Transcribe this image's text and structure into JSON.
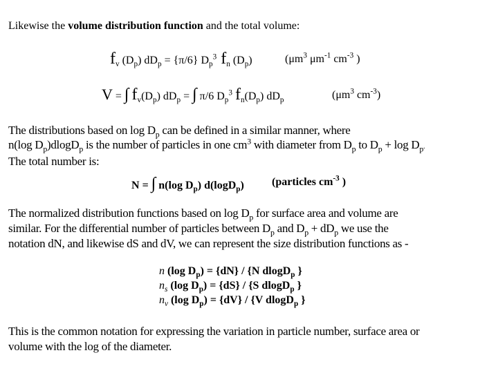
{
  "intro": {
    "prefix": "Likewise the ",
    "bold": "volume distribution function",
    "suffix": " and the total volume:"
  },
  "eq_volume_dist": {
    "f": "f",
    "sub_v": "v",
    "arg1": " (D",
    "p": "p",
    "close": ")",
    "dDp": " dD",
    "eq": " = {π/6} D",
    "cube": "3",
    "f2": " f",
    "sub_n": "n",
    "arg2": " (D",
    "units": "(μm",
    "u3": "3",
    "um": " μm",
    "um_exp": "-1",
    "cm": " cm",
    "cm_exp": "-3",
    "units_close": " )"
  },
  "eq_total_volume": {
    "V": "V",
    "eq": " = ",
    "integral": "∫",
    "f": "f",
    "sub_v": "v",
    "arg": "(D",
    "p": "p",
    "close": ")",
    "dDp": " dD",
    "eq2": " = ",
    "pi6": " π/6 D",
    "cube": "3",
    "f2": "f",
    "sub_n": "n",
    "units": "(μm",
    "u3": "3",
    "cm": " cm",
    "cm_exp": "-3",
    "units_close": ")"
  },
  "para_log": {
    "line1_a": "The distributions based on log D",
    "line1_p": "p",
    "line1_b": " can be defined in a similar manner, where",
    "line2_a": "n(log D",
    "line2_b": ")dlogD",
    "line2_c": " is the number of particles in one cm",
    "line2_exp": "3",
    "line2_d": " with diameter from D",
    "line2_e": " to D",
    "line2_f": " + log D",
    "line2_g": ".",
    "line3": "The total number is:"
  },
  "eq_total_number": {
    "N": "N",
    "eq": " = ",
    "integral": "∫",
    "body_a": " n(log D",
    "p": "p",
    "body_b": ") d(logD",
    "body_c": ")",
    "units": "(particles cm",
    "units_exp": "-3",
    "units_close": " )"
  },
  "para_normalized": {
    "line1_a": " The normalized distribution functions based on log D",
    "p": "p",
    "line1_b": " for surface area and volume are",
    "line2_a": "similar. For the differential number of particles between D",
    "line2_b": " and D",
    "line2_c": " + dD",
    "line2_d": " we use the",
    "line3": "notation dN, and likewise dS and dV, we can represent the size distribution functions as -"
  },
  "norm_equations": [
    {
      "n": "n",
      "sub": "",
      "mid": " (log D",
      "p": "p",
      "rest": ") = {dN} / {N dlogD",
      "end": " }"
    },
    {
      "n": "n",
      "sub": "s",
      "mid": " (log D",
      "p": "p",
      "rest": ") = {dS} / {S dlogD",
      "end": " }"
    },
    {
      "n": "n",
      "sub": "v",
      "mid": " (log D",
      "p": "p",
      "rest": ") = {dV} / {V dlogD",
      "end": " }"
    }
  ],
  "conclusion": {
    "line1": "This is the common notation for expressing the variation in particle number, surface area or",
    "line2": "volume with the log of the diameter."
  }
}
